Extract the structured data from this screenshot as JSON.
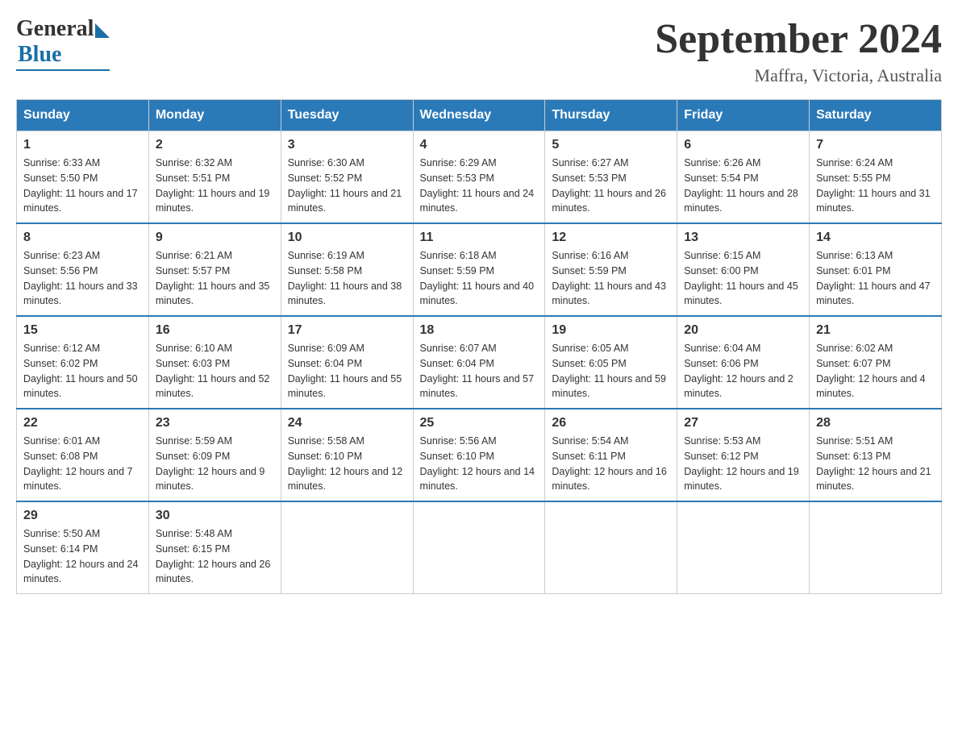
{
  "header": {
    "logo": {
      "general": "General",
      "blue": "Blue"
    },
    "title": "September 2024",
    "location": "Maffra, Victoria, Australia"
  },
  "days_of_week": [
    "Sunday",
    "Monday",
    "Tuesday",
    "Wednesday",
    "Thursday",
    "Friday",
    "Saturday"
  ],
  "weeks": [
    [
      {
        "num": "1",
        "sunrise": "6:33 AM",
        "sunset": "5:50 PM",
        "daylight": "11 hours and 17 minutes."
      },
      {
        "num": "2",
        "sunrise": "6:32 AM",
        "sunset": "5:51 PM",
        "daylight": "11 hours and 19 minutes."
      },
      {
        "num": "3",
        "sunrise": "6:30 AM",
        "sunset": "5:52 PM",
        "daylight": "11 hours and 21 minutes."
      },
      {
        "num": "4",
        "sunrise": "6:29 AM",
        "sunset": "5:53 PM",
        "daylight": "11 hours and 24 minutes."
      },
      {
        "num": "5",
        "sunrise": "6:27 AM",
        "sunset": "5:53 PM",
        "daylight": "11 hours and 26 minutes."
      },
      {
        "num": "6",
        "sunrise": "6:26 AM",
        "sunset": "5:54 PM",
        "daylight": "11 hours and 28 minutes."
      },
      {
        "num": "7",
        "sunrise": "6:24 AM",
        "sunset": "5:55 PM",
        "daylight": "11 hours and 31 minutes."
      }
    ],
    [
      {
        "num": "8",
        "sunrise": "6:23 AM",
        "sunset": "5:56 PM",
        "daylight": "11 hours and 33 minutes."
      },
      {
        "num": "9",
        "sunrise": "6:21 AM",
        "sunset": "5:57 PM",
        "daylight": "11 hours and 35 minutes."
      },
      {
        "num": "10",
        "sunrise": "6:19 AM",
        "sunset": "5:58 PM",
        "daylight": "11 hours and 38 minutes."
      },
      {
        "num": "11",
        "sunrise": "6:18 AM",
        "sunset": "5:59 PM",
        "daylight": "11 hours and 40 minutes."
      },
      {
        "num": "12",
        "sunrise": "6:16 AM",
        "sunset": "5:59 PM",
        "daylight": "11 hours and 43 minutes."
      },
      {
        "num": "13",
        "sunrise": "6:15 AM",
        "sunset": "6:00 PM",
        "daylight": "11 hours and 45 minutes."
      },
      {
        "num": "14",
        "sunrise": "6:13 AM",
        "sunset": "6:01 PM",
        "daylight": "11 hours and 47 minutes."
      }
    ],
    [
      {
        "num": "15",
        "sunrise": "6:12 AM",
        "sunset": "6:02 PM",
        "daylight": "11 hours and 50 minutes."
      },
      {
        "num": "16",
        "sunrise": "6:10 AM",
        "sunset": "6:03 PM",
        "daylight": "11 hours and 52 minutes."
      },
      {
        "num": "17",
        "sunrise": "6:09 AM",
        "sunset": "6:04 PM",
        "daylight": "11 hours and 55 minutes."
      },
      {
        "num": "18",
        "sunrise": "6:07 AM",
        "sunset": "6:04 PM",
        "daylight": "11 hours and 57 minutes."
      },
      {
        "num": "19",
        "sunrise": "6:05 AM",
        "sunset": "6:05 PM",
        "daylight": "11 hours and 59 minutes."
      },
      {
        "num": "20",
        "sunrise": "6:04 AM",
        "sunset": "6:06 PM",
        "daylight": "12 hours and 2 minutes."
      },
      {
        "num": "21",
        "sunrise": "6:02 AM",
        "sunset": "6:07 PM",
        "daylight": "12 hours and 4 minutes."
      }
    ],
    [
      {
        "num": "22",
        "sunrise": "6:01 AM",
        "sunset": "6:08 PM",
        "daylight": "12 hours and 7 minutes."
      },
      {
        "num": "23",
        "sunrise": "5:59 AM",
        "sunset": "6:09 PM",
        "daylight": "12 hours and 9 minutes."
      },
      {
        "num": "24",
        "sunrise": "5:58 AM",
        "sunset": "6:10 PM",
        "daylight": "12 hours and 12 minutes."
      },
      {
        "num": "25",
        "sunrise": "5:56 AM",
        "sunset": "6:10 PM",
        "daylight": "12 hours and 14 minutes."
      },
      {
        "num": "26",
        "sunrise": "5:54 AM",
        "sunset": "6:11 PM",
        "daylight": "12 hours and 16 minutes."
      },
      {
        "num": "27",
        "sunrise": "5:53 AM",
        "sunset": "6:12 PM",
        "daylight": "12 hours and 19 minutes."
      },
      {
        "num": "28",
        "sunrise": "5:51 AM",
        "sunset": "6:13 PM",
        "daylight": "12 hours and 21 minutes."
      }
    ],
    [
      {
        "num": "29",
        "sunrise": "5:50 AM",
        "sunset": "6:14 PM",
        "daylight": "12 hours and 24 minutes."
      },
      {
        "num": "30",
        "sunrise": "5:48 AM",
        "sunset": "6:15 PM",
        "daylight": "12 hours and 26 minutes."
      },
      null,
      null,
      null,
      null,
      null
    ]
  ]
}
